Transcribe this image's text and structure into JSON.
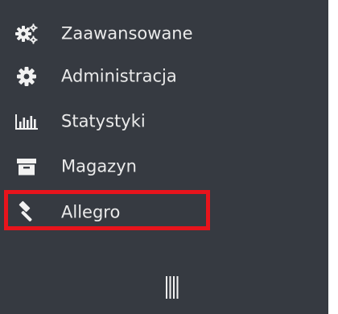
{
  "sidebar": {
    "items": [
      {
        "label": "Zaawansowane",
        "icon": "gears-icon"
      },
      {
        "label": "Administracja",
        "icon": "gear-icon"
      },
      {
        "label": "Statystyki",
        "icon": "bar-chart-icon"
      },
      {
        "label": "Magazyn",
        "icon": "archive-box-icon"
      },
      {
        "label": "Allegro",
        "icon": "gavel-icon",
        "highlighted": true
      }
    ],
    "collapse_toggle_icon": "collapse-bars-icon"
  },
  "colors": {
    "sidebar_background": "#363a41",
    "text": "#eaeaea",
    "icon": "#f2f2f2",
    "highlight": "#e8141c"
  }
}
